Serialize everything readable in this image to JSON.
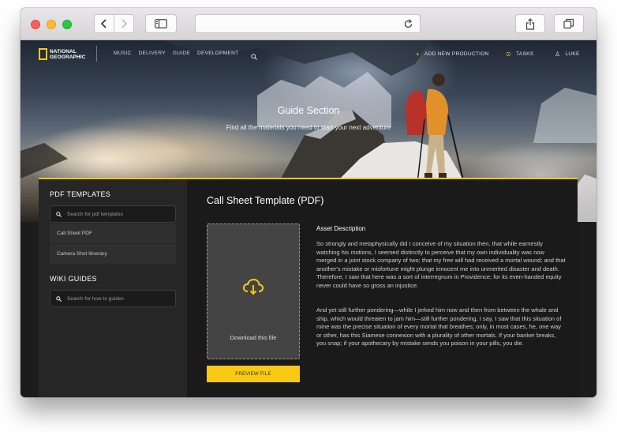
{
  "browser": {
    "back_icon": "chevron-left-icon",
    "forward_icon": "chevron-right-icon",
    "sidebar_icon": "sidebar-icon",
    "reload_icon": "reload-icon",
    "share_icon": "share-icon",
    "tabs_icon": "tabs-icon",
    "url": ""
  },
  "nav": {
    "logo_line1": "NATIONAL",
    "logo_line2": "GEOGRAPHIC",
    "links": [
      "MUSIC",
      "DELIVERY",
      "GUIDE",
      "DEVELOPMENT"
    ],
    "add_new": "ADD NEW PRODUCTION",
    "tasks": "TASKS",
    "user": "LUKE"
  },
  "hero": {
    "title": "Guide Section",
    "subtitle": "Find all the materials you need to start your next adventure"
  },
  "sidebar": {
    "pdf_heading": "PDF TEMPLATES",
    "pdf_search_placeholder": "Search for pdf templates",
    "pdf_items": [
      "Call Sheet PDF",
      "Camera Shot Itinerary"
    ],
    "wiki_heading": "WIKI GUIDES",
    "wiki_search_placeholder": "Search for how to guides"
  },
  "main": {
    "title": "Call Sheet Template (PDF)",
    "download_label": "Download this file",
    "preview_button": "PREVIEW FILE",
    "desc_heading": "Asset Description",
    "paragraph1": "So strongly and metaphysically did I conceive of my situation then, that while earnestly watching his motions, I seemed distinctly to perceive that my own individuality was now merged in a joint stock company of two; that my free will had received a mortal wound; and that another's mistake or misfortune might plunge innocent me into unmerited disaster and death. Therefore, I saw that here was a sort of interregnum in Providence; for its even-handed equity never could have so gross an injustice.",
    "paragraph2": "And yet still further pondering—while I jerked him now and then from between the whale and ship, which would threaten to jam him—still further pondering, I say, I saw that this situation of mine was the precise situation of every mortal that breathes; only, in most cases, he, one way or other, has this Siamese connexion with a plurality of other mortals. If your banker breaks, you snap; if your apothecary by mistake sends you poison in your pills, you die."
  },
  "colors": {
    "accent": "#f8c913",
    "panel": "#1a1a1a",
    "sidebar": "#262626"
  }
}
